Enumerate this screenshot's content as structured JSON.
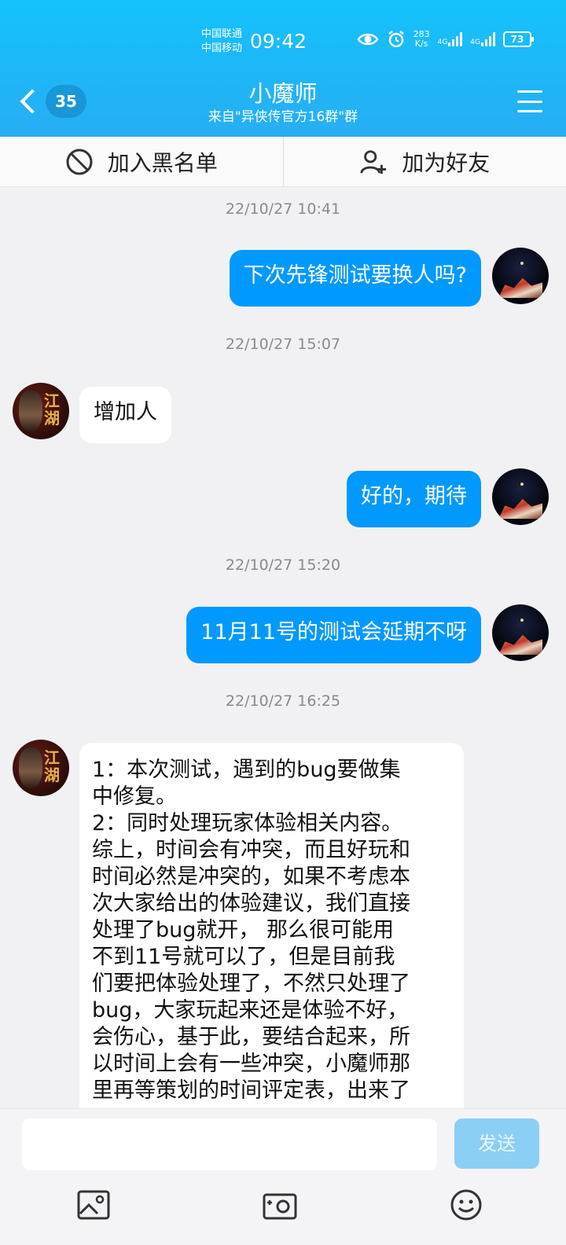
{
  "status": {
    "carrier1": "中国联通",
    "carrier2": "中国移动",
    "time": "09:42",
    "speed_value": "283",
    "speed_unit": "K/s",
    "net1": "4G",
    "net2": "4G",
    "battery": "73"
  },
  "header": {
    "unread_count": "35",
    "title": "小魔师",
    "subtitle": "来自\"异侠传官方16群\"群",
    "icons": {
      "back": "chevron-left-icon",
      "menu": "hamburger-menu-icon"
    },
    "accent": "#1eb6f7"
  },
  "actions": {
    "blacklist_label": "加入黑名单",
    "add_friend_label": "加为好友"
  },
  "messages": {
    "ts1": "22/10/27 10:41",
    "m1": "下次先锋测试要换人吗?",
    "ts2": "22/10/27 15:07",
    "m2": "增加人",
    "m3": "好的，期待",
    "ts3": "22/10/27 15:20",
    "m4": "11月11号的测试会延期不呀",
    "ts4": "22/10/27 16:25",
    "m5": "1：本次测试，遇到的bug要做集\n中修复。\n2：同时处理玩家体验相关内容。\n综上，时间会有冲突，而且好玩和\n时间必然是冲突的，如果不考虑本\n次大家给出的体验建议，我们直接\n处理了bug就开， 那么很可能用\n不到11号就可以了，但是目前我\n们要把体验处理了，不然只处理了\nbug，大家玩起来还是体验不好，\n会伤心，基于此，要结合起来，所\n以时间上会有一些冲突，小魔师那\n里再等策划的时间评定表，出来了",
    "bubble_me_color": "#0099ff",
    "avatar_other_glyph": "江湖"
  },
  "input": {
    "placeholder": "",
    "send_label": "发送",
    "tools": [
      "image-icon",
      "camera-icon",
      "emoji-icon"
    ]
  }
}
